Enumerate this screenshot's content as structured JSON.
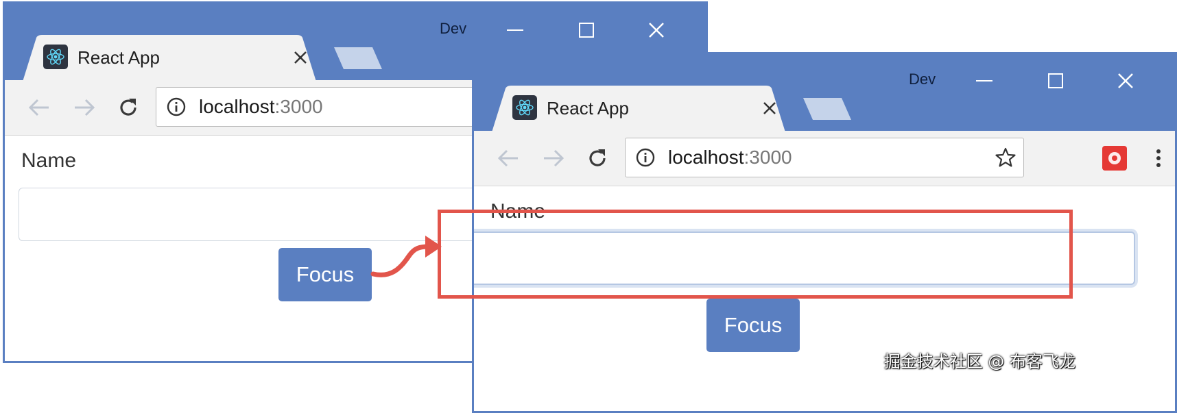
{
  "colors": {
    "chrome_blue": "#5a7fc1",
    "toolbar_gray": "#f2f2f2",
    "highlight_red": "#e2554b",
    "button_blue": "#5a7fc1"
  },
  "before_window": {
    "profile": "Dev",
    "tab": {
      "title": "React App",
      "icon": "react-icon"
    },
    "url": {
      "host": "localhost",
      "port": ":3000"
    },
    "form": {
      "label": "Name",
      "input_value": "",
      "button_label": "Focus"
    }
  },
  "after_window": {
    "profile": "Dev",
    "tab": {
      "title": "React App",
      "icon": "react-icon"
    },
    "url": {
      "host": "localhost",
      "port": ":3000"
    },
    "form": {
      "label": "Name",
      "input_value": "",
      "input_focused": true,
      "button_label": "Focus"
    }
  },
  "annotation": {
    "arrow": "curved-arrow-right",
    "highlight": "focused-input-box"
  },
  "watermark": "掘金技术社区 @ 布客飞龙"
}
